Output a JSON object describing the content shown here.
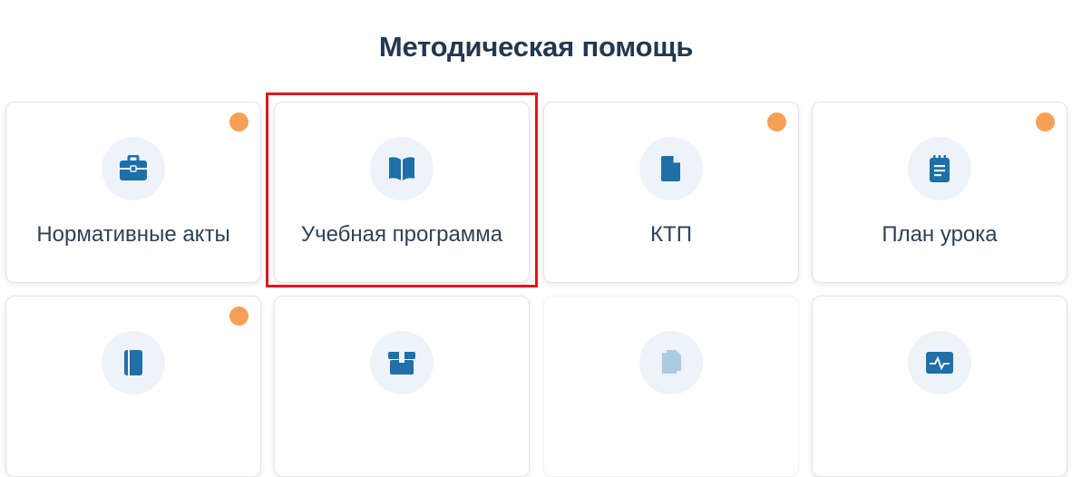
{
  "title": "Методическая помощь",
  "accent_color": "#1f6fa8",
  "badge_color": "#f7a055",
  "cards": [
    {
      "label": "Нормативные акты",
      "icon": "briefcase-icon",
      "badge": true
    },
    {
      "label": "Учебная программа",
      "icon": "book-icon",
      "badge": false,
      "highlighted": true
    },
    {
      "label": "КТП",
      "icon": "document-icon",
      "badge": true
    },
    {
      "label": "План урока",
      "icon": "notepad-icon",
      "badge": true
    },
    {
      "label": "",
      "icon": "notebook-icon",
      "badge": true
    },
    {
      "label": "",
      "icon": "box-icon",
      "badge": false
    },
    {
      "label": "",
      "icon": "documents-icon",
      "badge": false
    },
    {
      "label": "",
      "icon": "activity-icon",
      "badge": false
    }
  ]
}
